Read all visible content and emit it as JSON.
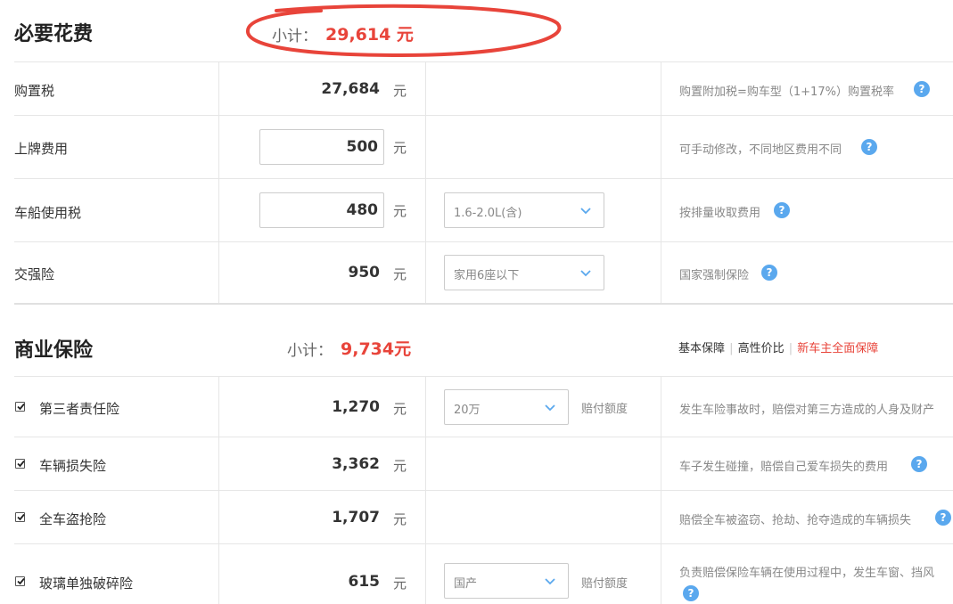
{
  "required": {
    "title": "必要花费",
    "subtotal_label": "小计：",
    "subtotal_value": "29,614 元",
    "rows": [
      {
        "label": "购置税",
        "amount": "27,684",
        "unit": "元",
        "note": "购置附加税=购车型（1+17%）购置税率"
      },
      {
        "label": "上牌费用",
        "amount": "500",
        "unit": "元",
        "note": "可手动修改，不同地区费用不同"
      },
      {
        "label": "车船使用税",
        "amount": "480",
        "unit": "元",
        "select": "1.6-2.0L(含)",
        "note": "按排量收取费用"
      },
      {
        "label": "交强险",
        "amount": "950",
        "unit": "元",
        "select": "家用6座以下",
        "note": "国家强制保险"
      }
    ]
  },
  "commercial": {
    "title": "商业保险",
    "subtotal_label": "小计：",
    "subtotal_value": "9,734元",
    "tabs": [
      "基本保障",
      "高性价比",
      "新车主全面保障"
    ],
    "tab_separator": "|",
    "active_tab": 2,
    "rows": [
      {
        "label": "第三者责任险",
        "amount": "1,270",
        "unit": "元",
        "select": "20万",
        "extra": "赔付额度",
        "note": "发生车险事故时，赔偿对第三方造成的人身及财产",
        "checked": true
      },
      {
        "label": "车辆损失险",
        "amount": "3,362",
        "unit": "元",
        "note": "车子发生碰撞，赔偿自己爱车损失的费用",
        "checked": true
      },
      {
        "label": "全车盗抢险",
        "amount": "1,707",
        "unit": "元",
        "note": "赔偿全车被盗窃、抢劫、抢夺造成的车辆损失",
        "checked": true
      },
      {
        "label": "玻璃单独破碎险",
        "amount": "615",
        "unit": "元",
        "select": "国产",
        "extra": "赔付额度",
        "note": "负责赔偿保险车辆在使用过程中，发生车窗、挡风",
        "checked": true
      }
    ]
  },
  "help_icon_glyph": "?",
  "colors": {
    "accent": "#e8443a",
    "help": "#5aa8ee",
    "annotation": "#e8443a"
  }
}
